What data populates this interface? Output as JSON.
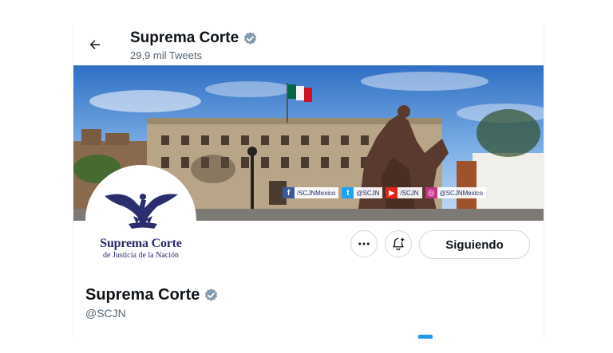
{
  "header": {
    "account_name": "Suprema Corte",
    "tweet_count": "29,9 mil Tweets"
  },
  "banner": {
    "social": [
      {
        "network": "facebook",
        "icon": "f",
        "color": "#3b5998",
        "handle": "/SCJNMexico"
      },
      {
        "network": "twitter",
        "icon": "t",
        "color": "#1da1f2",
        "handle": "@SCJN"
      },
      {
        "network": "youtube",
        "icon": "▶",
        "color": "#e62117",
        "handle": "/SCJN"
      },
      {
        "network": "instagram",
        "icon": "◎",
        "color": "#c13584",
        "handle": "@SCJNMexico"
      }
    ]
  },
  "avatar": {
    "title": "Suprema Corte",
    "subtitle": "de Justicia de la Nación"
  },
  "actions": {
    "follow_label": "Siguiendo"
  },
  "profile": {
    "name": "Suprema Corte",
    "handle": "@SCJN"
  },
  "colors": {
    "verified": "#829aab",
    "text_primary": "#0f1419",
    "text_secondary": "#536471",
    "border": "#cfd9de",
    "avatar_brand": "#2a2d6e"
  },
  "icons": {
    "back": "arrow-left-icon",
    "more": "more-dots-icon",
    "notify": "bell-plus-icon",
    "verified": "verified-badge-icon"
  }
}
